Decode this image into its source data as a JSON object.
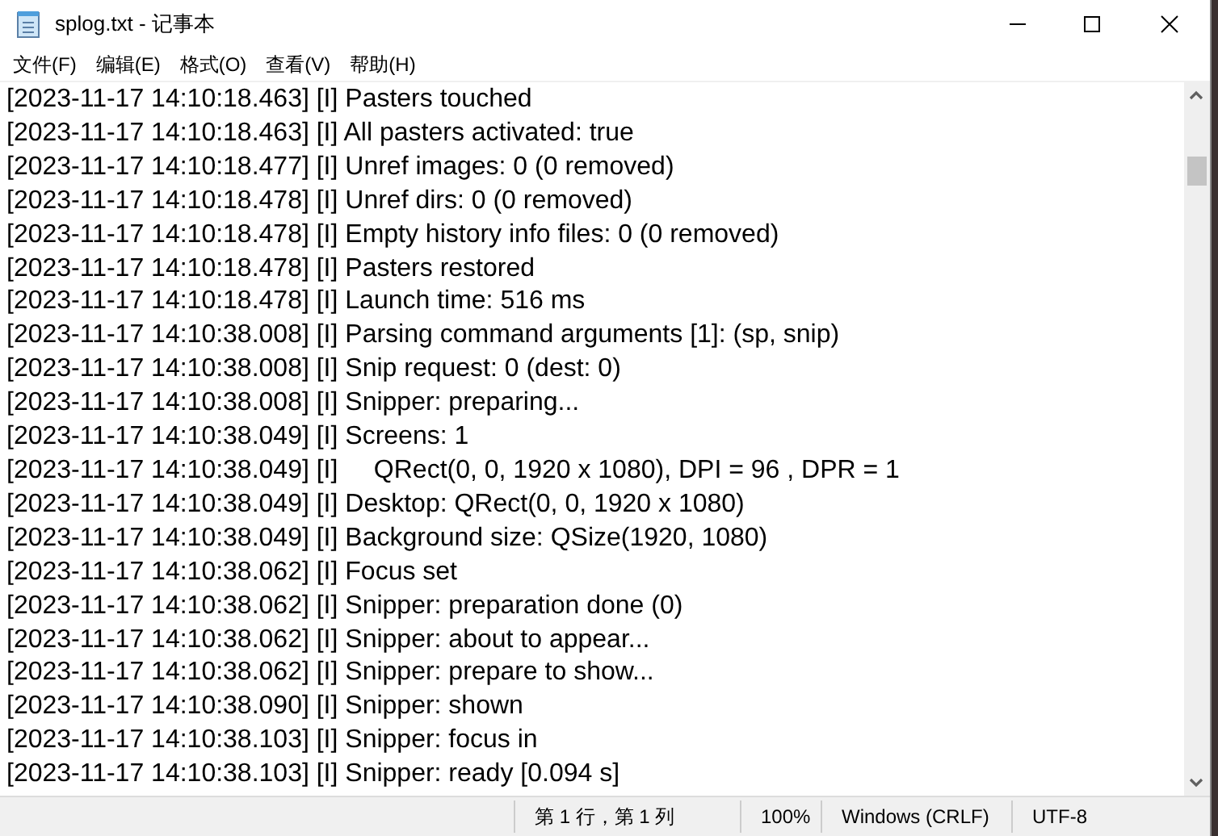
{
  "window": {
    "title": "splog.txt - 记事本"
  },
  "menu": [
    "文件(F)",
    "编辑(E)",
    "格式(O)",
    "查看(V)",
    "帮助(H)"
  ],
  "lines": [
    "[2023-11-17 14:10:18.463] [I] Pasters touched",
    "[2023-11-17 14:10:18.463] [I] All pasters activated: true",
    "[2023-11-17 14:10:18.477] [I] Unref images: 0 (0 removed)",
    "[2023-11-17 14:10:18.478] [I] Unref dirs: 0 (0 removed)",
    "[2023-11-17 14:10:18.478] [I] Empty history info files: 0 (0 removed)",
    "[2023-11-17 14:10:18.478] [I] Pasters restored",
    "[2023-11-17 14:10:18.478] [I] Launch time: 516 ms",
    "[2023-11-17 14:10:38.008] [I] Parsing command arguments [1]: (sp, snip)",
    "[2023-11-17 14:10:38.008] [I] Snip request: 0 (dest: 0)",
    "[2023-11-17 14:10:38.008] [I] Snipper: preparing...",
    "[2023-11-17 14:10:38.049] [I] Screens: 1",
    "[2023-11-17 14:10:38.049] [I]     QRect(0, 0, 1920 x 1080), DPI = 96 , DPR = 1",
    "[2023-11-17 14:10:38.049] [I] Desktop: QRect(0, 0, 1920 x 1080)",
    "[2023-11-17 14:10:38.049] [I] Background size: QSize(1920, 1080)",
    "[2023-11-17 14:10:38.062] [I] Focus set",
    "[2023-11-17 14:10:38.062] [I] Snipper: preparation done (0)",
    "[2023-11-17 14:10:38.062] [I] Snipper: about to appear...",
    "[2023-11-17 14:10:38.062] [I] Snipper: prepare to show...",
    "[2023-11-17 14:10:38.090] [I] Snipper: shown",
    "[2023-11-17 14:10:38.103] [I] Snipper: focus in",
    "[2023-11-17 14:10:38.103] [I] Snipper: ready [0.094 s]"
  ],
  "status_bar": [
    "第 1 行，第 1 列",
    "100%",
    "Windows (CRLF)",
    "UTF-8"
  ]
}
